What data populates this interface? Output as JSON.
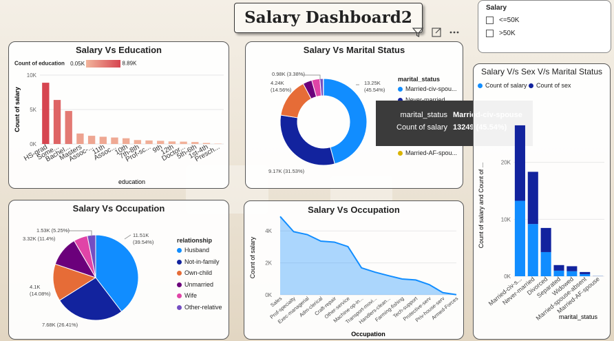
{
  "page_title": "Salary Dashboard2",
  "icons": [
    "filter-icon",
    "focus-mode-icon",
    "more-options-icon"
  ],
  "slicer": {
    "title": "Salary",
    "options": [
      "<=50K",
      ">50K"
    ]
  },
  "colors": {
    "blue": "#118dff",
    "navy": "#12239e",
    "orange": "#e66c37",
    "purple": "#6b007b",
    "pink": "#e044a7",
    "violet": "#744ec2",
    "yellow": "#d9b300",
    "red": "#d64550",
    "light_red": "#e8957a"
  },
  "tooltip": {
    "rows": [
      {
        "key": "marital_status",
        "value": "Married-civ-spouse"
      },
      {
        "key": "Count of salary",
        "value": "13249 (45.54%)"
      }
    ]
  },
  "chart_data": [
    {
      "id": "education",
      "type": "bar",
      "title": "Salary Vs Education",
      "xlabel": "education",
      "ylabel": "Count of salary",
      "ylim": [
        0,
        10000
      ],
      "yticks": [
        "0K",
        "5K",
        "10K"
      ],
      "gradient_legend": {
        "label": "Count of education",
        "min": "0.05K",
        "max": "8.89K"
      },
      "categories": [
        "HS-grad",
        "Some...",
        "BacheI...",
        "Masters",
        "Assoc-...",
        "11th",
        "Assoc...",
        "10th",
        "7th-8th",
        "Prof-sc...",
        "9th",
        "12th",
        "Doctor...",
        "5th-6th",
        "1st-4th",
        "Presch..."
      ],
      "values": [
        8890,
        6390,
        4790,
        1520,
        1190,
        1050,
        940,
        830,
        570,
        510,
        460,
        370,
        340,
        290,
        150,
        50
      ]
    },
    {
      "id": "marital",
      "type": "pie",
      "title": "Salary Vs Marital Status",
      "legend_title": "marital_status",
      "legend": [
        "Married-civ-spouse",
        "Never-married",
        "Divorced",
        "Separated",
        "Widowed",
        "Married-spouse-absent",
        "Married-AF-spouse"
      ],
      "legend_display": [
        "Married-civ-spou...",
        "Never-married",
        "Divorced",
        "Separated",
        "Widowed",
        "Married-spouse-...",
        "Married-AF-spou..."
      ],
      "values": [
        13249,
        9170,
        4240,
        980,
        880,
        370,
        20
      ],
      "labels": [
        "13.25K\n(45.54%)",
        "9.17K (31.53%)",
        "4.24K\n(14.56%)",
        "0.98K (3.38%)"
      ]
    },
    {
      "id": "relationship",
      "type": "pie",
      "title": "Salary Vs Occupation",
      "legend_title": "relationship",
      "legend": [
        "Husband",
        "Not-in-family",
        "Own-child",
        "Unmarried",
        "Wife",
        "Other-relative"
      ],
      "values": [
        11510,
        7680,
        4100,
        3320,
        1530,
        920
      ],
      "labels": [
        "11.51K\n(39.54%)",
        "7.68K (26.41%)",
        "4.1K\n(14.08%)",
        "3.32K (11.4%)",
        "1.53K (5.25%)"
      ]
    },
    {
      "id": "occupation",
      "type": "area",
      "title": "Salary Vs Occupation",
      "xlabel": "Occupation",
      "ylabel": "Count of salary",
      "ylim": [
        0,
        5000
      ],
      "yticks": [
        "0K",
        "2K",
        "4K"
      ],
      "categories": [
        "Sales",
        "Prof-specialty",
        "Exec-managerial",
        "Adm-clerical",
        "Craft-repair",
        "Other-service",
        "Machine-op-in...",
        "Transport-movi...",
        "Handlers-clean...",
        "Farming-fishing",
        "Tech-support",
        "Protective-serv",
        "Priv-house-serv",
        "Armed-Forces"
      ],
      "values": [
        4900,
        3950,
        3770,
        3360,
        3300,
        3020,
        1690,
        1420,
        1200,
        990,
        930,
        640,
        140,
        10
      ]
    },
    {
      "id": "sex_marital",
      "type": "bar",
      "title": "Salary V/s Sex V/s Marital Status",
      "xlabel": "marital_status",
      "ylabel": "Count of salary and Count of ...",
      "ylim": [
        0,
        30000
      ],
      "yticks": [
        "0K",
        "10K",
        "20K"
      ],
      "legend": [
        "Count of salary",
        "Count of sex"
      ],
      "categories": [
        "Married-civ-s...",
        "Never-married",
        "Divorced",
        "Separated",
        "Widowed",
        "Married-spouse-absent",
        "Married-AF-spouse"
      ],
      "series": [
        {
          "name": "Count of salary",
          "values": [
            13250,
            9170,
            4240,
            980,
            880,
            370,
            20
          ]
        },
        {
          "name": "Count of sex",
          "values": [
            13250,
            9170,
            4240,
            980,
            880,
            370,
            20
          ]
        }
      ]
    }
  ]
}
